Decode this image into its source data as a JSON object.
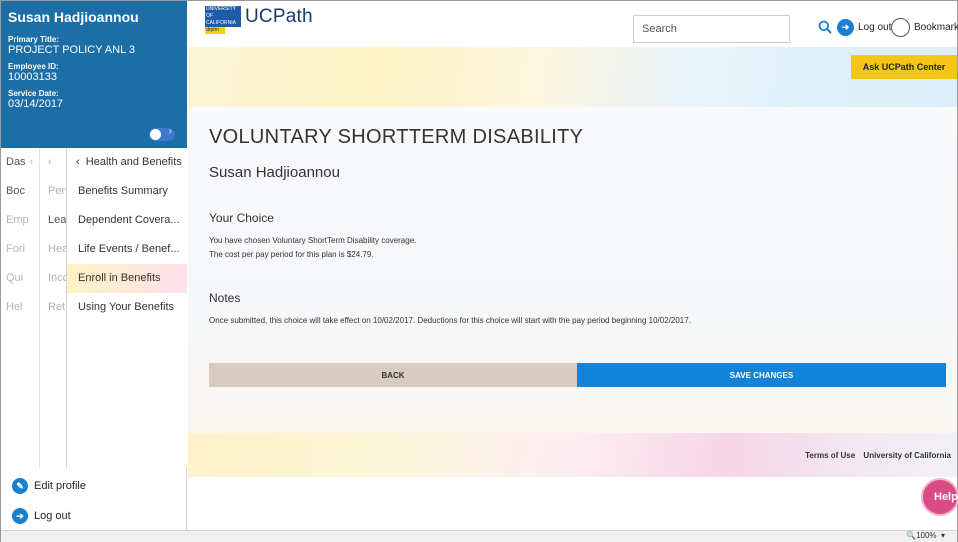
{
  "profile": {
    "name": "Susan Hadjioannou",
    "primary_title_label": "Primary Title:",
    "primary_title": "PROJECT POLICY ANL 3",
    "employee_id_label": "Employee ID:",
    "employee_id": "10003133",
    "service_date_label": "Service Date:",
    "service_date": "03/14/2017"
  },
  "menu_level1": [
    "Das",
    "Boc",
    "Emp",
    "Fori",
    "Qui",
    "Hel"
  ],
  "menu_level2": [
    "",
    "Pers",
    "Lea",
    "Hea",
    "Inco",
    "Ret"
  ],
  "menu_level3": {
    "back_label": "Health and Benefits",
    "items": [
      "Benefits Summary",
      "Dependent Covera...",
      "Life Events / Benef...",
      "Enroll in Benefits",
      "Using Your Benefits"
    ],
    "active_index": 3
  },
  "sidebar_bottom": {
    "edit_profile": "Edit profile",
    "log_out": "Log out"
  },
  "header": {
    "logo_lines": [
      "UNIVERSITY",
      "OF",
      "CALIFORNIA"
    ],
    "logo_tag": "drptrn",
    "app_title": "UCPath",
    "search_placeholder": "Search",
    "logout_label": "Log out",
    "bookmark_label": "Bookmark"
  },
  "banner": {
    "ask_button": "Ask UCPath Center"
  },
  "main": {
    "title": "VOLUNTARY SHORTTERM DISABILITY",
    "person": "Susan Hadjioannou",
    "choice_heading": "Your Choice",
    "choice_line1": "You have chosen Voluntary ShortTerm Disability coverage.",
    "choice_line2": "The cost per pay period for this plan is $24.79.",
    "notes_heading": "Notes",
    "notes_text": "Once submitted, this choice will take effect on 10/02/2017. Deductions for this choice will start with the pay period beginning 10/02/2017.",
    "back_button": "BACK",
    "save_button": "SAVE CHANGES"
  },
  "footer": {
    "terms": "Terms of Use",
    "university": "University of California"
  },
  "help_button": "Help",
  "statusbar": {
    "zoom": "100%"
  },
  "colors": {
    "profile_bg": "#1c6ea6",
    "primary_blue": "#1283d8",
    "ask_yellow": "#f5c518",
    "back_tan": "#d7ccbf",
    "help_pink": "#d84b86"
  }
}
